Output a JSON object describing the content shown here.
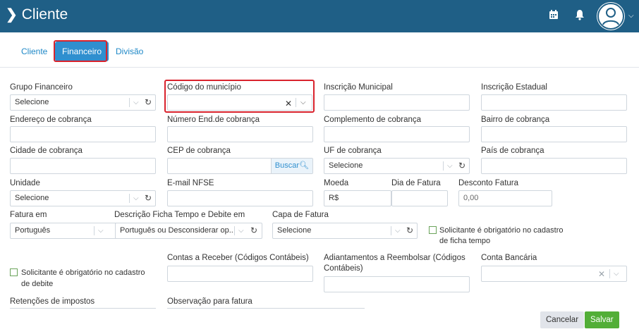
{
  "header": {
    "title": "Cliente"
  },
  "tabs": [
    {
      "label": "Cliente"
    },
    {
      "label": "Financeiro"
    },
    {
      "label": "Divisão"
    }
  ],
  "fields": {
    "grupo_financeiro": {
      "label": "Grupo Financeiro",
      "value": "Selecione"
    },
    "codigo_municipio": {
      "label": "Código do município",
      "value": ""
    },
    "inscricao_municipal": {
      "label": "Inscrição Municipal",
      "value": ""
    },
    "inscricao_estadual": {
      "label": "Inscrição Estadual",
      "value": ""
    },
    "endereco_cobranca": {
      "label": "Endereço de cobrança",
      "value": ""
    },
    "numero_end_cobranca": {
      "label": "Número End.de cobrança",
      "value": ""
    },
    "complemento_cobranca": {
      "label": "Complemento de cobrança",
      "value": ""
    },
    "bairro_cobranca": {
      "label": "Bairro de cobrança",
      "value": ""
    },
    "cidade_cobranca": {
      "label": "Cidade de cobrança",
      "value": ""
    },
    "cep_cobranca": {
      "label": "CEP de cobrança",
      "value": "",
      "button": "Buscar"
    },
    "uf_cobranca": {
      "label": "UF de cobrança",
      "value": "Selecione"
    },
    "pais_cobranca": {
      "label": "País de cobrança",
      "value": ""
    },
    "unidade": {
      "label": "Unidade",
      "value": "Selecione"
    },
    "email_nfse": {
      "label": "E-mail NFSE",
      "value": ""
    },
    "moeda": {
      "label": "Moeda",
      "value": "R$"
    },
    "dia_fatura": {
      "label": "Dia de Fatura",
      "value": ""
    },
    "desconto_fatura": {
      "label": "Desconto Fatura",
      "value": "0,00"
    },
    "fatura_em": {
      "label": "Fatura em",
      "value": "Português"
    },
    "descricao_ficha": {
      "label": "Descrição Ficha Tempo e Debite em",
      "value": "Português ou Desconsiderar op..."
    },
    "capa_fatura": {
      "label": "Capa de Fatura",
      "value": "Selecione"
    },
    "solicitante_ficha": {
      "label_line1": "Solicitante é obrigatório no cadastro",
      "label_line2": "de ficha tempo"
    },
    "contas_receber": {
      "label": "Contas a Receber (Códigos Contábeis)",
      "value": ""
    },
    "adiantamentos": {
      "label_line1": "Adiantamentos a Reembolsar (Códigos",
      "label_line2": "Contábeis)",
      "value": ""
    },
    "conta_bancaria": {
      "label": "Conta Bancária",
      "value": ""
    },
    "solicitante_debite": {
      "label_line1": "Solicitante é obrigatório no cadastro",
      "label_line2": "de debite"
    },
    "retencoes": {
      "label": "Retenções de impostos"
    },
    "observacao": {
      "label": "Observação para fatura"
    }
  },
  "actions": {
    "cancel": "Cancelar",
    "save": "Salvar"
  },
  "colors": {
    "header_bg": "#1f5f86",
    "accent": "#2f8fcf",
    "highlight": "#d9232d",
    "save_bg": "#52ae37"
  }
}
